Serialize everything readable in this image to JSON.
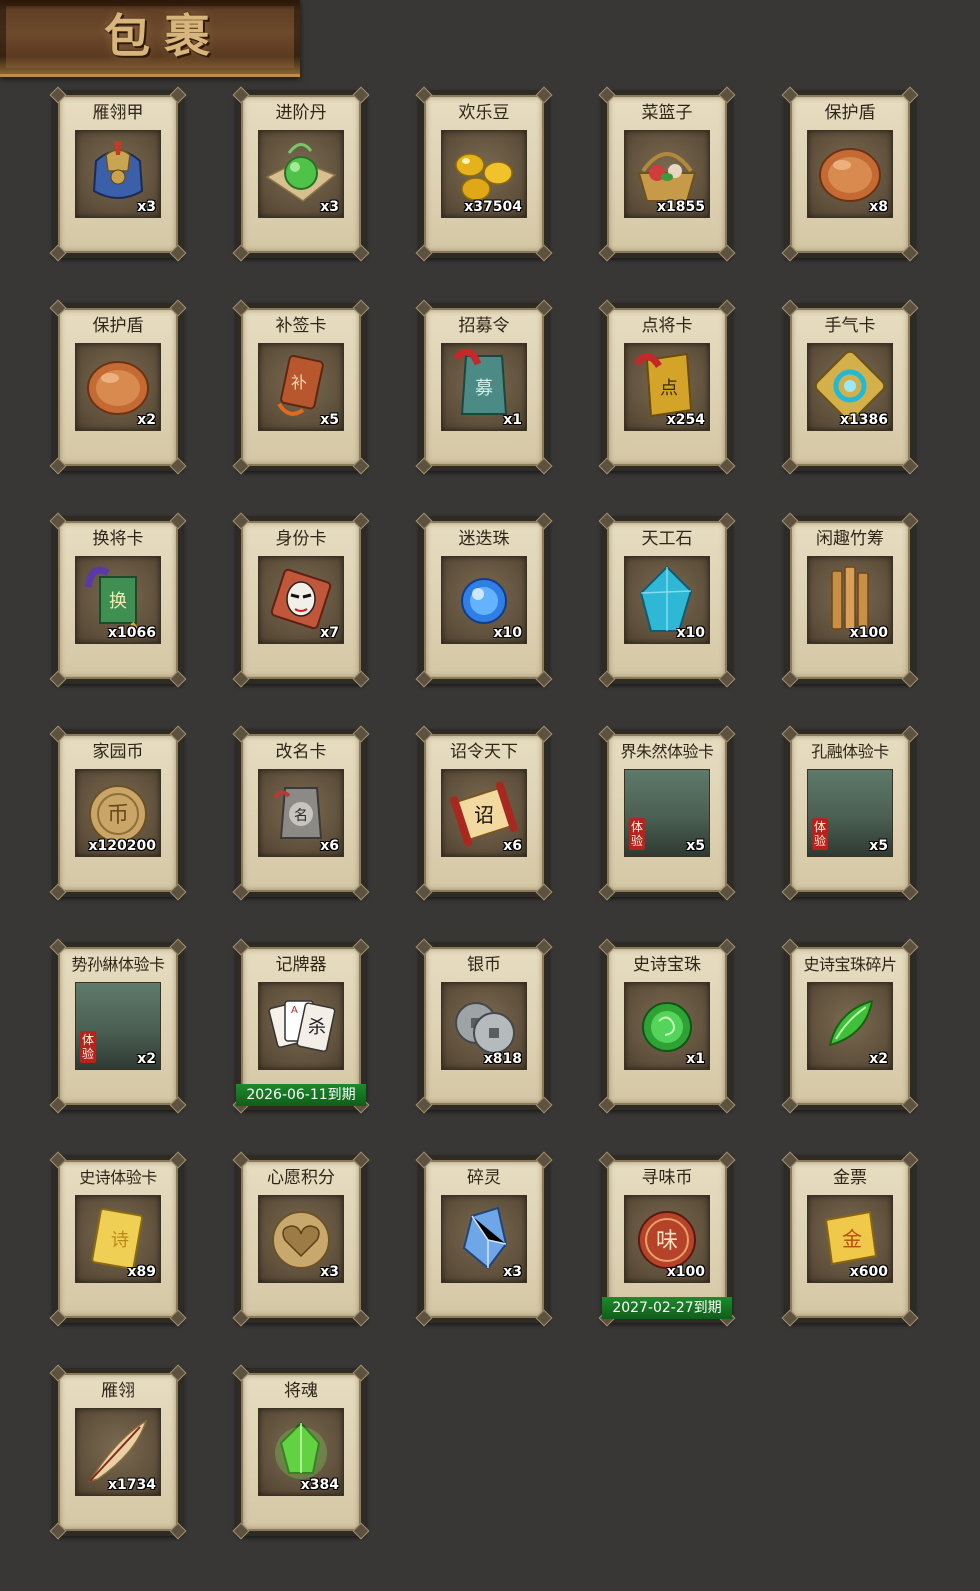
{
  "header": {
    "title": "包裹"
  },
  "items": [
    {
      "name": "雁翎甲",
      "qty": "x3",
      "icon": "armor-icon"
    },
    {
      "name": "进阶丹",
      "qty": "x3",
      "icon": "green-pill-icon"
    },
    {
      "name": "欢乐豆",
      "qty": "x37504",
      "icon": "gold-beans-icon"
    },
    {
      "name": "菜篮子",
      "qty": "x1855",
      "icon": "basket-icon"
    },
    {
      "name": "保护盾",
      "qty": "x8",
      "icon": "shield-icon"
    },
    {
      "name": "保护盾",
      "qty": "x2",
      "icon": "shield-icon"
    },
    {
      "name": "补签卡",
      "qty": "x5",
      "icon": "sign-card-icon"
    },
    {
      "name": "招募令",
      "qty": "x1",
      "icon": "recruit-token-icon"
    },
    {
      "name": "点将卡",
      "qty": "x254",
      "icon": "general-card-icon"
    },
    {
      "name": "手气卡",
      "qty": "x1386",
      "icon": "luck-card-icon"
    },
    {
      "name": "换将卡",
      "qty": "x1066",
      "icon": "swap-card-icon"
    },
    {
      "name": "身份卡",
      "qty": "x7",
      "icon": "mask-card-icon"
    },
    {
      "name": "迷迭珠",
      "qty": "x10",
      "icon": "blue-orb-icon"
    },
    {
      "name": "天工石",
      "qty": "x10",
      "icon": "blue-crystal-icon"
    },
    {
      "name": "闲趣竹筹",
      "qty": "x100",
      "icon": "bamboo-slips-icon"
    },
    {
      "name": "家园币",
      "qty": "x120200",
      "icon": "home-coin-icon"
    },
    {
      "name": "改名卡",
      "qty": "x6",
      "icon": "rename-card-icon"
    },
    {
      "name": "诏令天下",
      "qty": "x6",
      "icon": "edict-scroll-icon"
    },
    {
      "name": "界朱然体验卡",
      "qty": "x5",
      "icon": "hero-portrait-icon",
      "trial": "体验"
    },
    {
      "name": "孔融体验卡",
      "qty": "x5",
      "icon": "hero-portrait-icon",
      "trial": "体验"
    },
    {
      "name": "势孙綝体验卡",
      "qty": "x2",
      "icon": "hero-portrait-icon",
      "trial": "体验"
    },
    {
      "name": "记牌器",
      "qty": "",
      "icon": "playing-cards-icon",
      "expiry": "2026-06-11到期"
    },
    {
      "name": "银币",
      "qty": "x818",
      "icon": "silver-coin-icon"
    },
    {
      "name": "史诗宝珠",
      "qty": "x1",
      "icon": "green-orb-icon"
    },
    {
      "name": "史诗宝珠碎片",
      "qty": "x2",
      "icon": "green-shard-icon"
    },
    {
      "name": "史诗体验卡",
      "qty": "x89",
      "icon": "gold-card-icon"
    },
    {
      "name": "心愿积分",
      "qty": "x3",
      "icon": "heart-coin-icon"
    },
    {
      "name": "碎灵",
      "qty": "x3",
      "icon": "crystal-shard-icon"
    },
    {
      "name": "寻味币",
      "qty": "x100",
      "icon": "flavor-coin-icon",
      "expiry": "2027-02-27到期"
    },
    {
      "name": "金票",
      "qty": "x600",
      "icon": "gold-ticket-icon"
    },
    {
      "name": "雁翎",
      "qty": "x1734",
      "icon": "feather-icon"
    },
    {
      "name": "将魂",
      "qty": "x384",
      "icon": "green-soul-icon"
    }
  ],
  "colors": {
    "background": "#383736",
    "card_paper": "#e0d5b7",
    "expiry_green": "#1d8a2c",
    "trial_red": "#b8221d"
  }
}
